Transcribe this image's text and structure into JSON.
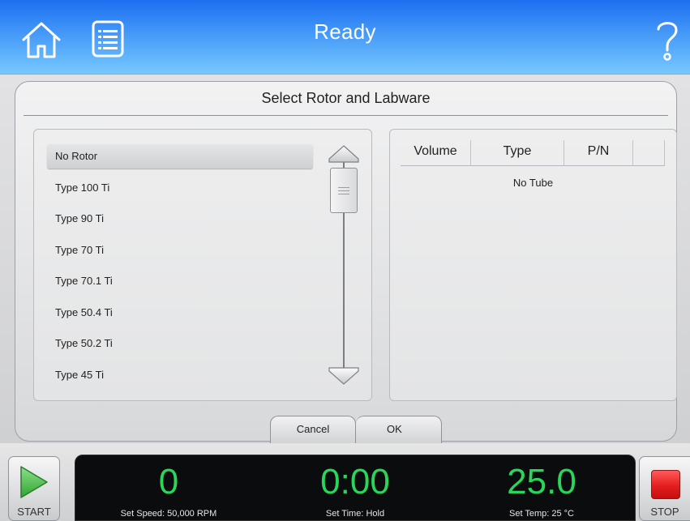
{
  "header": {
    "title": "Ready",
    "icons": [
      "home-icon",
      "menu-list-icon",
      "help-icon"
    ],
    "gradient_top": "#1e6ff0",
    "gradient_bottom": "#78c8fd"
  },
  "dialog": {
    "title": "Select Rotor and Labware",
    "rotors": [
      {
        "label": "No Rotor",
        "selected": true
      },
      {
        "label": "Type 100 Ti",
        "selected": false
      },
      {
        "label": "Type 90 Ti",
        "selected": false
      },
      {
        "label": "Type 70 Ti",
        "selected": false
      },
      {
        "label": "Type 70.1 Ti",
        "selected": false
      },
      {
        "label": "Type 50.4 Ti",
        "selected": false
      },
      {
        "label": "Type 50.2 Ti",
        "selected": false
      },
      {
        "label": "Type 45 Ti",
        "selected": false
      }
    ],
    "tube_columns": [
      "Volume",
      "Type",
      "P/N",
      ""
    ],
    "tube_empty": "No Tube",
    "cancel_label": "Cancel",
    "ok_label": "OK"
  },
  "status": {
    "speed": "0",
    "speed_label": "Set Speed: 50,000 RPM",
    "time": "0:00",
    "time_label": "Set Time: Hold",
    "temp": "25.0",
    "temp_label": "Set Temp: 25 °C",
    "value_color": "#29d65a"
  },
  "controls": {
    "start_label": "START",
    "stop_label": "STOP",
    "start_color": "#3fb83f",
    "stop_color": "#e51e1e"
  }
}
